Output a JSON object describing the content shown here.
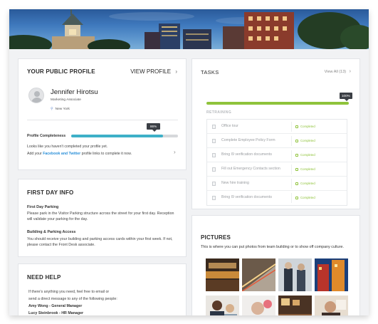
{
  "profile": {
    "heading": "YOUR PUBLIC PROFILE",
    "view_link": "VIEW PROFILE",
    "name": "Jennifer Hirotsu",
    "title": "Marketing Associate",
    "location": "New York",
    "completeness_label": "Profile Completeness",
    "completeness_tag": "86%",
    "completeness_fraction": 0.86,
    "note_line1": "Looks like you haven't completed your profile yet.",
    "note_prefix": "Add your ",
    "note_links": "Facebook and Twitter",
    "note_suffix": " profile links to complete it now."
  },
  "first_day": {
    "heading": "FIRST DAY INFO",
    "parking_heading": "First Day Parking",
    "parking_text": "Please park in the Visitor Parking structure across the street for your first day. Reception will validate your parking for the day.",
    "access_heading": "Building & Parking Access",
    "access_text": "You should receive your building and parking access cards within your first week. If not, please contact the Front Desk associate."
  },
  "help": {
    "heading": "NEED HELP",
    "line1": "If there's anything you need, feel free to email or",
    "line2": "send a direct message to any of the following people:",
    "contact1": "Amy Wong - General Manager",
    "contact2": "Lucy Steinbrook - HR Manager"
  },
  "tasks": {
    "heading": "TASKS",
    "view_all": "View All (13)",
    "progress_tag": "100%",
    "progress_fraction": 1.0,
    "section": "RETRAINING",
    "status_text": "Completed",
    "items": [
      "Office tour",
      "Complete Employee Policy Form",
      "Bring I9 verification documents",
      "Fill out Emergency Contacts section",
      "New hire training",
      "Bring I9 verification documents"
    ]
  },
  "pictures": {
    "heading": "PICTURES",
    "description": "This is where you can put photos from team building or to show off company culture."
  },
  "colors": {
    "accent_teal": "#3eb0c8",
    "success_green": "#8fc33b",
    "link_blue": "#2a8fd8"
  }
}
